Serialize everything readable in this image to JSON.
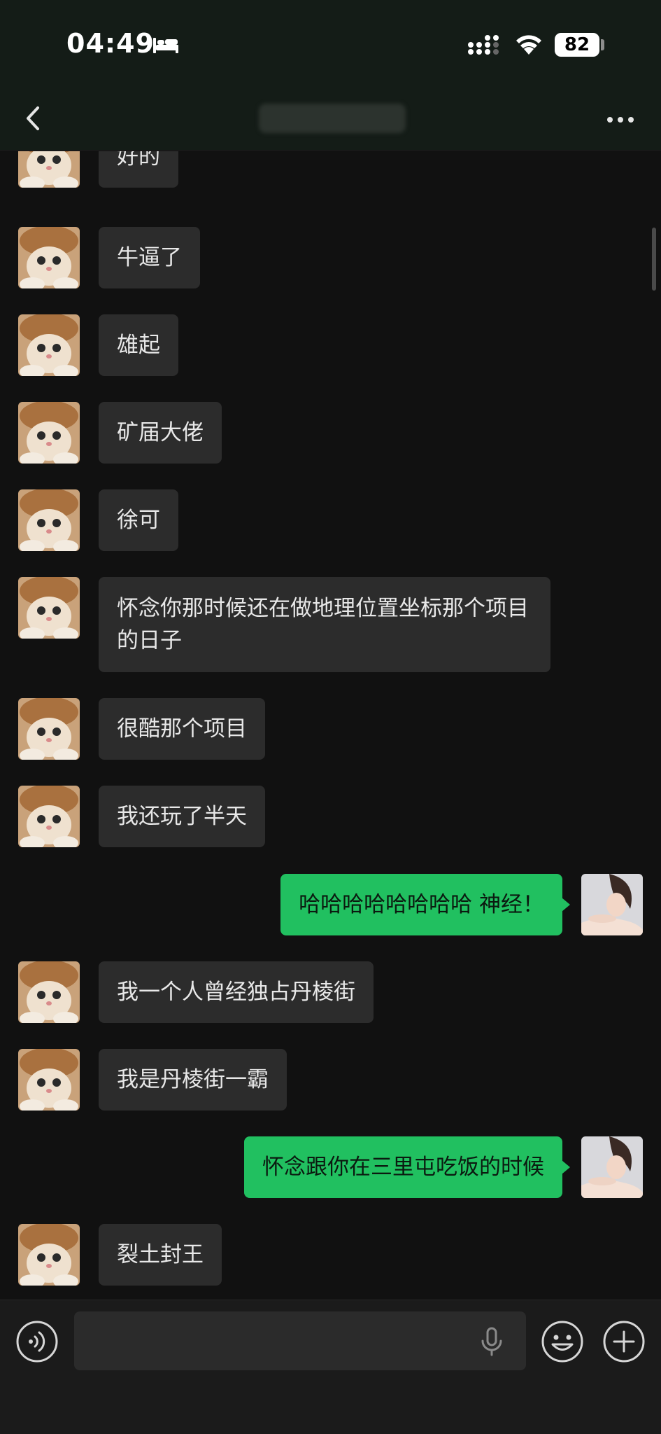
{
  "status_bar": {
    "time": "04:49",
    "battery": "82"
  },
  "nav": {
    "title": ""
  },
  "messages": [
    {
      "side": "in",
      "text": "好的"
    },
    {
      "side": "in",
      "text": "牛逼了"
    },
    {
      "side": "in",
      "text": "雄起"
    },
    {
      "side": "in",
      "text": "矿届大佬"
    },
    {
      "side": "in",
      "text": "徐可"
    },
    {
      "side": "in",
      "text": "怀念你那时候还在做地理位置坐标那个项目的日子"
    },
    {
      "side": "in",
      "text": "很酷那个项目"
    },
    {
      "side": "in",
      "text": "我还玩了半天"
    },
    {
      "side": "out",
      "text": "哈哈哈哈哈哈哈哈 神经！"
    },
    {
      "side": "in",
      "text": "我一个人曾经独占丹棱街"
    },
    {
      "side": "in",
      "text": "我是丹棱街一霸"
    },
    {
      "side": "out",
      "text": "怀念跟你在三里屯吃饭的时候"
    },
    {
      "side": "in",
      "text": "裂土封王"
    }
  ],
  "colors": {
    "outgoing_bubble": "#21c060",
    "incoming_bubble": "#2c2c2c",
    "background": "#111111"
  }
}
